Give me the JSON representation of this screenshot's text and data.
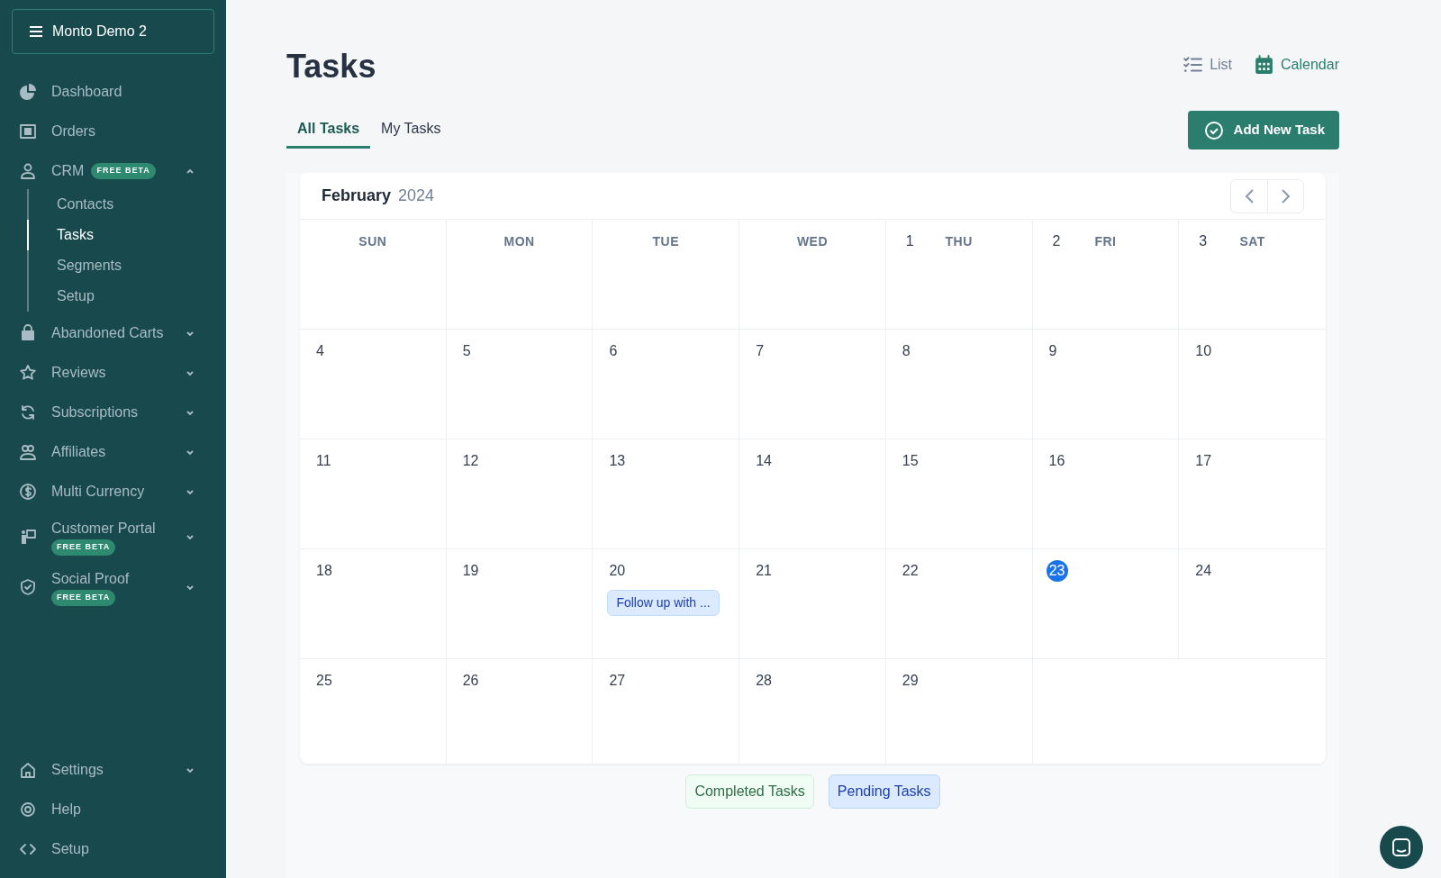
{
  "workspace": {
    "name": "Monto Demo 2"
  },
  "sidebar": {
    "items": [
      {
        "label": "Dashboard",
        "selected": false
      },
      {
        "label": "Orders",
        "selected": false
      },
      {
        "label": "CRM",
        "badge": "FREE BETA",
        "expanded": true,
        "selected": false,
        "children": [
          {
            "label": "Contacts",
            "selected": false
          },
          {
            "label": "Tasks",
            "selected": true
          },
          {
            "label": "Segments",
            "selected": false
          },
          {
            "label": "Setup",
            "selected": false
          }
        ]
      },
      {
        "label": "Abandoned Carts",
        "expanded": false,
        "selected": false
      },
      {
        "label": "Reviews",
        "expanded": false,
        "selected": false
      },
      {
        "label": "Subscriptions",
        "expanded": false,
        "selected": false
      },
      {
        "label": "Affiliates",
        "expanded": false,
        "selected": false
      },
      {
        "label": "Multi Currency",
        "expanded": false,
        "selected": false
      },
      {
        "label": "Customer Portal",
        "badge": "FREE BETA",
        "expanded": false,
        "selected": false
      },
      {
        "label": "Social Proof",
        "badge": "FREE BETA",
        "expanded": false,
        "selected": false
      }
    ],
    "bottom_items": [
      {
        "label": "Settings",
        "expanded": false,
        "selected": false
      },
      {
        "label": "Help",
        "selected": false
      },
      {
        "label": "Setup",
        "selected": false
      }
    ]
  },
  "page": {
    "title": "Tasks",
    "views": [
      {
        "label": "List",
        "selected": false
      },
      {
        "label": "Calendar",
        "selected": true
      }
    ],
    "tabs": [
      {
        "label": "All Tasks",
        "selected": true
      },
      {
        "label": "My Tasks",
        "selected": false
      }
    ],
    "add_button": "Add New Task"
  },
  "calendar": {
    "month": "February",
    "year": "2024",
    "headers": [
      {
        "label": "SUN"
      },
      {
        "label": "MON"
      },
      {
        "label": "TUE"
      },
      {
        "label": "WED"
      },
      {
        "label": "THU",
        "date": "1"
      },
      {
        "label": "FRI",
        "date": "2"
      },
      {
        "label": "SAT",
        "date": "3"
      }
    ],
    "weeks": [
      [
        {
          "date": "4"
        },
        {
          "date": "5"
        },
        {
          "date": "6"
        },
        {
          "date": "7"
        },
        {
          "date": "8"
        },
        {
          "date": "9"
        },
        {
          "date": "10"
        }
      ],
      [
        {
          "date": "11"
        },
        {
          "date": "12"
        },
        {
          "date": "13"
        },
        {
          "date": "14"
        },
        {
          "date": "15"
        },
        {
          "date": "16"
        },
        {
          "date": "17"
        }
      ],
      [
        {
          "date": "18"
        },
        {
          "date": "19"
        },
        {
          "date": "20",
          "tasks": [
            {
              "title": "Follow up with ..."
            }
          ]
        },
        {
          "date": "21"
        },
        {
          "date": "22"
        },
        {
          "date": "23",
          "today": true
        },
        {
          "date": "24"
        }
      ],
      [
        {
          "date": "25"
        },
        {
          "date": "26"
        },
        {
          "date": "27"
        },
        {
          "date": "28"
        },
        {
          "date": "29"
        }
      ]
    ]
  },
  "legend": [
    {
      "label": "Completed Tasks",
      "kind": "completed"
    },
    {
      "label": "Pending Tasks",
      "kind": "pending"
    }
  ]
}
